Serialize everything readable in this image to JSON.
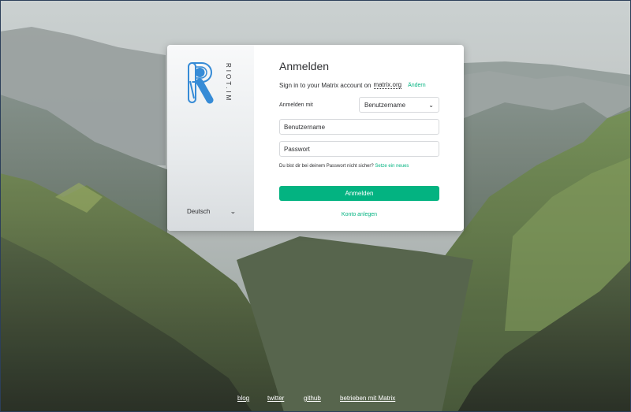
{
  "brand": {
    "logo_letter": "R",
    "logo_text": "RIOT.IM"
  },
  "language": {
    "selected": "Deutsch"
  },
  "login": {
    "title": "Anmelden",
    "server_prefix": "Sign in to your Matrix account on",
    "server_name": "matrix.org",
    "change_label": "Ändern",
    "login_with_label": "Anmelden mit",
    "login_type_selected": "Benutzername",
    "username_placeholder": "Benutzername",
    "password_placeholder": "Passwort",
    "forgot_text": "Du bist dir bei deinem Passwort nicht sicher?",
    "reset_label": "Setze ein neues",
    "submit_label": "Anmelden",
    "create_account_label": "Konto anlegen"
  },
  "footer": {
    "blog": "blog",
    "twitter": "twitter",
    "github": "github",
    "powered": "betrieben mit Matrix"
  },
  "colors": {
    "accent": "#03b381",
    "logo_blue": "#368bd6",
    "text": "#2e2f32"
  },
  "icons": {
    "dropdown": "chevron-down-icon",
    "logo": "riot-logo-icon"
  }
}
